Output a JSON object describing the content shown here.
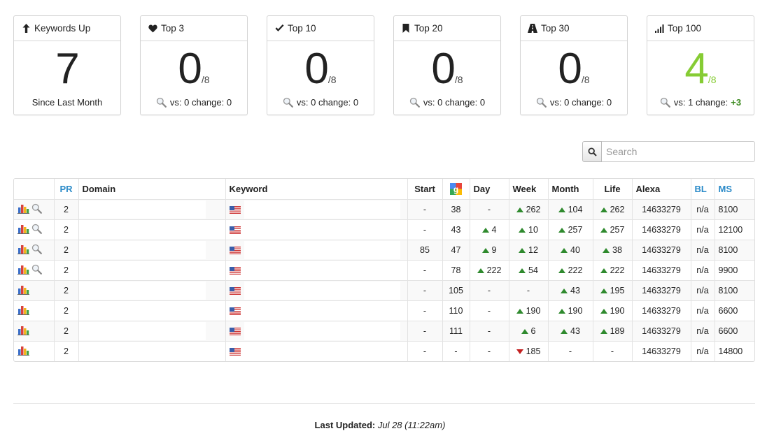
{
  "cards": [
    {
      "title": "Keywords Up",
      "icon": "arrow-up-icon",
      "value": "7",
      "denominator": "",
      "footer": "Since Last Month",
      "highlight": false
    },
    {
      "title": "Top 3",
      "icon": "heart-icon",
      "value": "0",
      "denominator": "/8",
      "footer": "vs: 0 change: 0",
      "highlight": false
    },
    {
      "title": "Top 10",
      "icon": "check-icon",
      "value": "0",
      "denominator": "/8",
      "footer": "vs: 0 change: 0",
      "highlight": false
    },
    {
      "title": "Top 20",
      "icon": "bookmark-icon",
      "value": "0",
      "denominator": "/8",
      "footer": "vs: 0 change: 0",
      "highlight": false
    },
    {
      "title": "Top 30",
      "icon": "road-icon",
      "value": "0",
      "denominator": "/8",
      "footer": "vs: 0 change: 0",
      "highlight": false
    },
    {
      "title": "Top 100",
      "icon": "signal-icon",
      "value": "4",
      "denominator": "/8",
      "footer": "vs: 1 change:",
      "change": "+3",
      "highlight": true
    }
  ],
  "search": {
    "placeholder": "Search"
  },
  "table": {
    "headers": [
      "",
      "PR",
      "Domain",
      "Keyword",
      "Start",
      "",
      "Day",
      "Week",
      "Month",
      "Life",
      "Alexa",
      "BL",
      "MS"
    ],
    "rows": [
      {
        "search_icon": true,
        "pr": "2",
        "start": "-",
        "google": "38",
        "day": {
          "v": "-",
          "d": ""
        },
        "week": {
          "v": "262",
          "d": "up"
        },
        "month": {
          "v": "104",
          "d": "up"
        },
        "life": {
          "v": "262",
          "d": "up"
        },
        "alexa": "14633279",
        "bl": "n/a",
        "ms": "8100"
      },
      {
        "search_icon": true,
        "pr": "2",
        "start": "-",
        "google": "43",
        "day": {
          "v": "4",
          "d": "up"
        },
        "week": {
          "v": "10",
          "d": "up"
        },
        "month": {
          "v": "257",
          "d": "up"
        },
        "life": {
          "v": "257",
          "d": "up"
        },
        "alexa": "14633279",
        "bl": "n/a",
        "ms": "12100"
      },
      {
        "search_icon": true,
        "pr": "2",
        "start": "85",
        "google": "47",
        "day": {
          "v": "9",
          "d": "up"
        },
        "week": {
          "v": "12",
          "d": "up"
        },
        "month": {
          "v": "40",
          "d": "up"
        },
        "life": {
          "v": "38",
          "d": "up"
        },
        "alexa": "14633279",
        "bl": "n/a",
        "ms": "8100"
      },
      {
        "search_icon": true,
        "pr": "2",
        "start": "-",
        "google": "78",
        "day": {
          "v": "222",
          "d": "up"
        },
        "week": {
          "v": "54",
          "d": "up"
        },
        "month": {
          "v": "222",
          "d": "up"
        },
        "life": {
          "v": "222",
          "d": "up"
        },
        "alexa": "14633279",
        "bl": "n/a",
        "ms": "9900"
      },
      {
        "search_icon": false,
        "pr": "2",
        "start": "-",
        "google": "105",
        "day": {
          "v": "-",
          "d": ""
        },
        "week": {
          "v": "-",
          "d": ""
        },
        "month": {
          "v": "43",
          "d": "up"
        },
        "life": {
          "v": "195",
          "d": "up"
        },
        "alexa": "14633279",
        "bl": "n/a",
        "ms": "8100"
      },
      {
        "search_icon": false,
        "pr": "2",
        "start": "-",
        "google": "110",
        "day": {
          "v": "-",
          "d": ""
        },
        "week": {
          "v": "190",
          "d": "up"
        },
        "month": {
          "v": "190",
          "d": "up"
        },
        "life": {
          "v": "190",
          "d": "up"
        },
        "alexa": "14633279",
        "bl": "n/a",
        "ms": "6600"
      },
      {
        "search_icon": false,
        "pr": "2",
        "start": "-",
        "google": "111",
        "day": {
          "v": "-",
          "d": ""
        },
        "week": {
          "v": "6",
          "d": "up"
        },
        "month": {
          "v": "43",
          "d": "up"
        },
        "life": {
          "v": "189",
          "d": "up"
        },
        "alexa": "14633279",
        "bl": "n/a",
        "ms": "6600"
      },
      {
        "search_icon": false,
        "pr": "2",
        "start": "-",
        "google": "-",
        "day": {
          "v": "-",
          "d": ""
        },
        "week": {
          "v": "185",
          "d": "down"
        },
        "month": {
          "v": "-",
          "d": ""
        },
        "life": {
          "v": "-",
          "d": ""
        },
        "alexa": "14633279",
        "bl": "n/a",
        "ms": "14800"
      }
    ]
  },
  "footer": {
    "label": "Last Updated:",
    "value": "Jul 28 (11:22am)"
  },
  "colors": {
    "accent_blue": "#2a8ac8",
    "highlight_green": "#86cc34",
    "up_green": "#2f8a2e",
    "down_red": "#c32020"
  }
}
